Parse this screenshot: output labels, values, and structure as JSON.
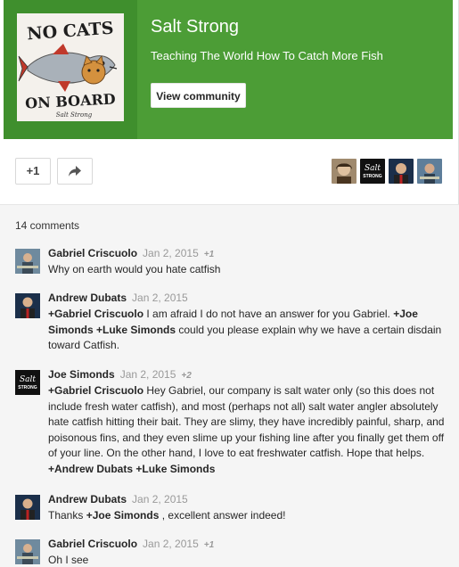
{
  "community": {
    "logo_line1": "NO CATS",
    "logo_line2": "ON BOARD",
    "logo_small": "Salt Strong",
    "name": "Salt Strong",
    "tagline": "Teaching The World How To Catch More Fish",
    "view_button": "View community"
  },
  "actions": {
    "plus_one": "+1"
  },
  "avatars": {
    "salt_logo_text_top": "Salt",
    "salt_logo_text_bottom": "STRONG"
  },
  "comments": {
    "count_label": "14 comments",
    "items": [
      {
        "author": "Gabriel Criscuolo",
        "date": "Jan 2, 2015",
        "plus": "+1",
        "text": "Why on earth would you hate catfish"
      },
      {
        "author": "Andrew Dubats",
        "date": "Jan 2, 2015",
        "plus": "",
        "mention1": "+Gabriel Criscuolo",
        "text1": " I am afraid I do not have an answer for you Gabriel. ",
        "mention2": "+Joe Simonds",
        "text2": "  ",
        "mention3": "+Luke Simonds",
        "text3": "  could you please explain why we have a certain disdain toward Catfish."
      },
      {
        "author": "Joe Simonds",
        "date": "Jan 2, 2015",
        "plus": "+2",
        "mention1": "+Gabriel Criscuolo",
        "text1": " Hey Gabriel, our company is salt water only (so this does not include fresh water catfish), and most (perhaps not all) salt water angler absolutely hate catfish hitting their bait. They are slimy, they have incredibly painful, sharp, and poisonous fins, and they even slime up your fishing line after you finally get them off of your line. On the other hand, I love to eat freshwater catfish. Hope that helps. ",
        "mention2": "+Andrew Dubats",
        "text2": " ",
        "mention3": "+Luke Simonds"
      },
      {
        "author": "Andrew Dubats",
        "date": "Jan 2, 2015",
        "plus": "",
        "text1": "Thanks ",
        "mention1": "+Joe Simonds",
        "text2": " , excellent answer indeed!"
      },
      {
        "author": "Gabriel Criscuolo",
        "date": "Jan 2, 2015",
        "plus": "+1",
        "text": "Oh I see"
      }
    ]
  }
}
